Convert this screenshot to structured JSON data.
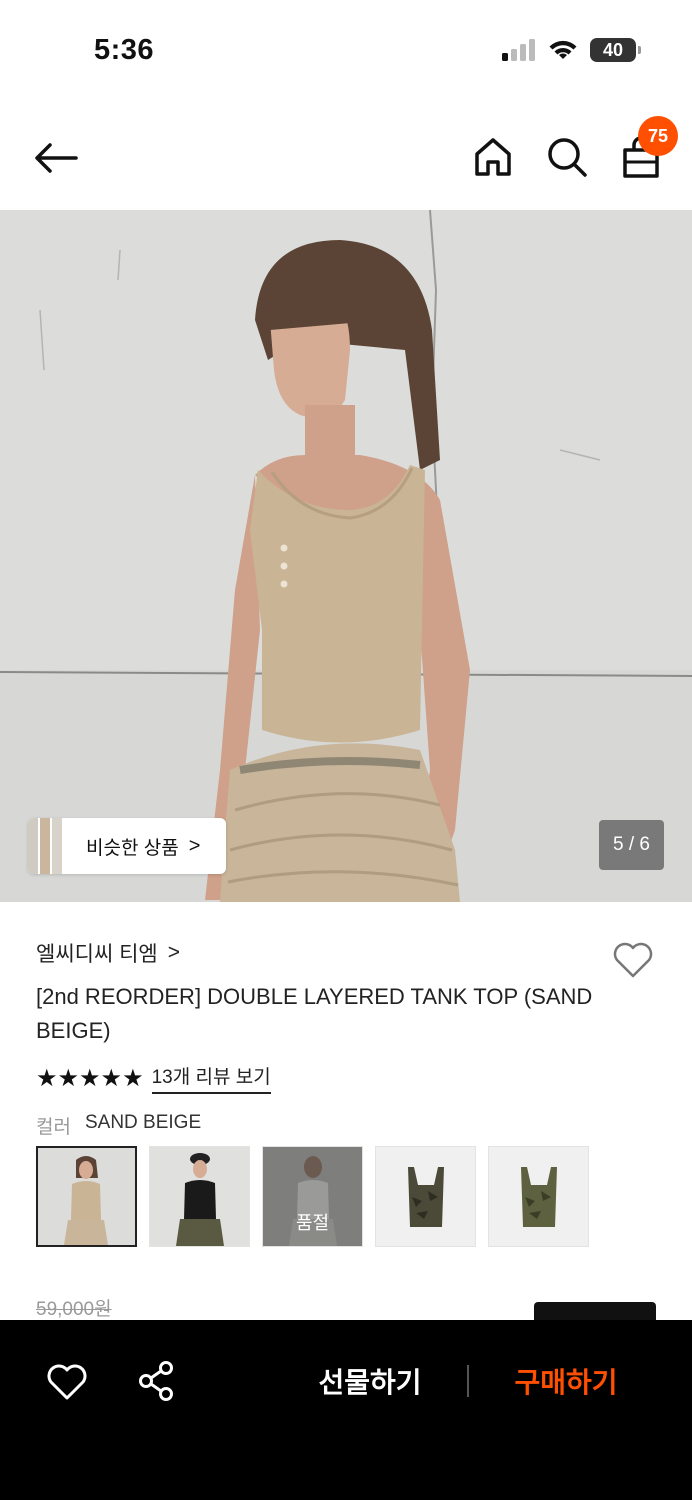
{
  "status_bar": {
    "time": "5:36",
    "battery": "40"
  },
  "nav": {
    "cart_count": "75",
    "icons": [
      "back-arrow-icon",
      "home-icon",
      "search-icon",
      "shopping-bag-icon"
    ]
  },
  "hero": {
    "similar_label": "비슷한 상품",
    "similar_chevron": ">",
    "page_indicator": "5 / 6"
  },
  "product": {
    "brand": "엘씨디씨 티엠",
    "brand_chevron": ">",
    "title": "[2nd REORDER] DOUBLE LAYERED TANK TOP (SAND BEIGE)",
    "stars": "★★★★★",
    "rating": 5,
    "review_link": "13개 리뷰 보기",
    "color_key": "컬러",
    "color_value": "SAND BEIGE",
    "swatches": [
      {
        "selected": true,
        "sold_out": false
      },
      {
        "selected": false,
        "sold_out": false
      },
      {
        "selected": false,
        "sold_out": true,
        "label": "품절"
      },
      {
        "selected": false,
        "sold_out": false
      },
      {
        "selected": false,
        "sold_out": false
      }
    ],
    "original_price": "59,000원"
  },
  "bottom_bar": {
    "gift_label": "선물하기",
    "buy_label": "구매하기"
  },
  "colors": {
    "accent": "#ff4f00",
    "bar_bg": "#000000"
  }
}
